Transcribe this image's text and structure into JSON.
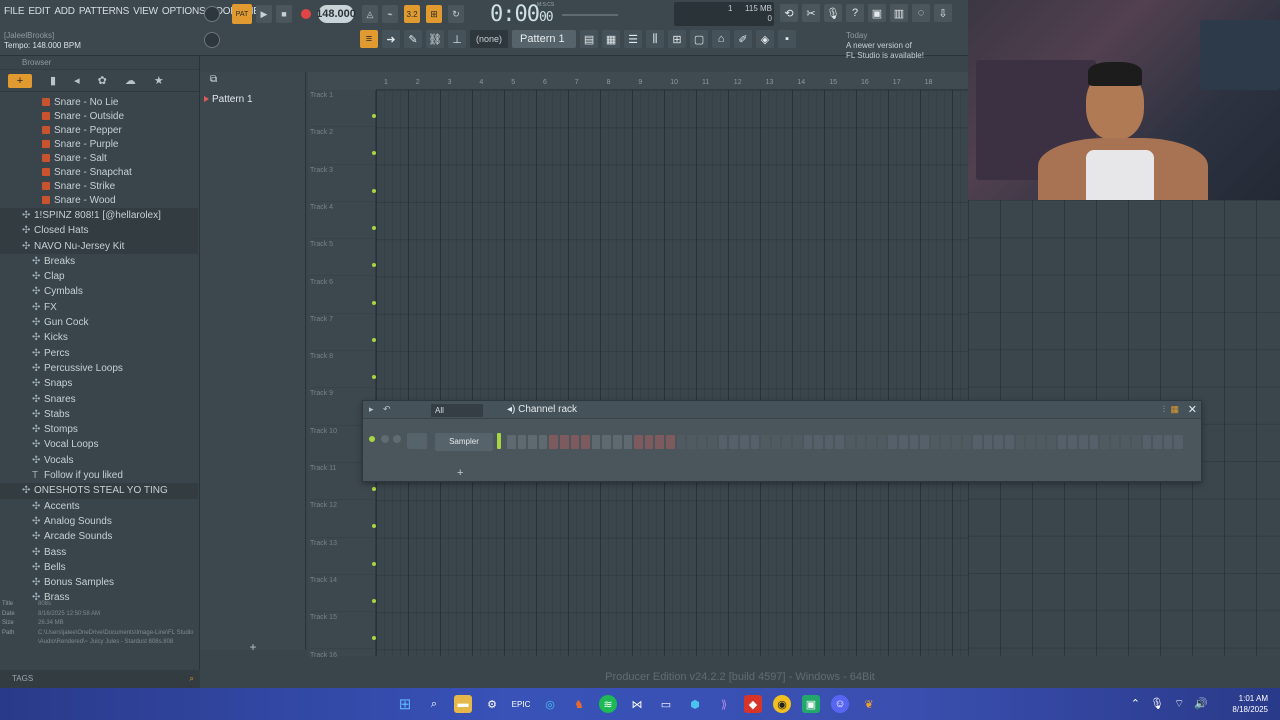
{
  "menu": [
    "FILE",
    "EDIT",
    "ADD",
    "PATTERNS",
    "VIEW",
    "OPTIONS",
    "TOOLS",
    "HELP"
  ],
  "hint": {
    "user": "[JaleelBrooks]",
    "tempo": "Tempo: 148.000 BPM"
  },
  "transport": {
    "mode": "PAT",
    "tempo": "148.000",
    "time_main": "0:00",
    "time_sub": "00",
    "time_units": "M:S:CS",
    "snap": "3.2",
    "memory": "115 MB",
    "cpu": "1",
    "voices": "0"
  },
  "toolbar2": {
    "snap_value": "(none)",
    "pattern": "Pattern 1"
  },
  "notice": {
    "today": "Today",
    "line1": "A newer version of",
    "line2": "FL Studio is available!"
  },
  "browser": {
    "title": "Browser",
    "files": [
      "Snare - No Lie",
      "Snare - Outside",
      "Snare - Pepper",
      "Snare - Purple",
      "Snare - Salt",
      "Snare - Snapchat",
      "Snare - Strike",
      "Snare - Wood"
    ],
    "folders": [
      {
        "label": "1!SPINZ 808!1 [@hellarolex]",
        "level": 0
      },
      {
        "label": "Closed Hats",
        "level": 0
      },
      {
        "label": "NAVO Nu-Jersey Kit",
        "level": 0
      },
      {
        "label": "Breaks",
        "level": 1
      },
      {
        "label": "Clap",
        "level": 1
      },
      {
        "label": "Cymbals",
        "level": 1
      },
      {
        "label": "FX",
        "level": 1
      },
      {
        "label": "Gun Cock",
        "level": 1
      },
      {
        "label": "Kicks",
        "level": 1
      },
      {
        "label": "Percs",
        "level": 1
      },
      {
        "label": "Percussive Loops",
        "level": 1
      },
      {
        "label": "Snaps",
        "level": 1
      },
      {
        "label": "Snares",
        "level": 1
      },
      {
        "label": "Stabs",
        "level": 1
      },
      {
        "label": "Stomps",
        "level": 1
      },
      {
        "label": "Vocal Loops",
        "level": 1
      },
      {
        "label": "Vocals",
        "level": 1
      },
      {
        "label": "Follow if you liked",
        "level": 1,
        "text": true
      },
      {
        "label": "ONESHOTS STEAL YO TING",
        "level": 0
      },
      {
        "label": "Accents",
        "level": 1
      },
      {
        "label": "Analog Sounds",
        "level": 1
      },
      {
        "label": "Arcade Sounds",
        "level": 1
      },
      {
        "label": "Bass",
        "level": 1
      },
      {
        "label": "Bells",
        "level": 1
      },
      {
        "label": "Bonus Samples",
        "level": 1
      },
      {
        "label": "Brass",
        "level": 1
      }
    ],
    "info": {
      "title_k": "Title",
      "title_v": "808s",
      "date_k": "Date",
      "date_v": "8/16/2025 12:50:58 AM",
      "size_k": "Size",
      "size_v": "26.34 MB",
      "path_k": "Path",
      "path_v": "C:\\Users\\jalee\\OneDrive\\Documents\\Image-Line\\FL Studio\\Audio\\Rendered\\~ Juicy Jules - Stardust 808s.808"
    },
    "tags": "TAGS"
  },
  "picker": {
    "pattern": "Pattern 1"
  },
  "playlist": {
    "bars": [
      "1",
      "2",
      "3",
      "4",
      "5",
      "6",
      "7",
      "8",
      "9",
      "10",
      "11",
      "12",
      "13",
      "14",
      "15",
      "16",
      "17",
      "18"
    ],
    "tracks": [
      "Track 1",
      "Track 2",
      "Track 3",
      "Track 4",
      "Track 5",
      "Track 6",
      "Track 7",
      "Track 8",
      "Track 9",
      "Track 10",
      "Track 11",
      "Track 12",
      "Track 13",
      "Track 14",
      "Track 15",
      "Track 16"
    ]
  },
  "channel_rack": {
    "filter": "All",
    "title": "Channel rack",
    "channel": "Sampler",
    "step_count": 64,
    "red_group_count": 16
  },
  "status": "Producer Edition v24.2.2 [build 4597] - Windows - 64Bit",
  "clock": {
    "time": "1:01 AM",
    "date": "8/18/2025"
  },
  "colors": {
    "accent": "#e09a2f",
    "bg": "#3a454b",
    "taskbar": "#3852b8"
  }
}
